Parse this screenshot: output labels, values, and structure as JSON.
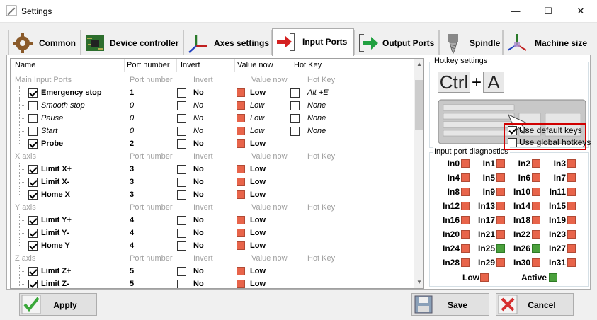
{
  "window": {
    "title": "Settings",
    "min": "—",
    "max": "☐",
    "close": "✕"
  },
  "tabs": [
    {
      "label": "Common"
    },
    {
      "label": "Device controller"
    },
    {
      "label": "Axes settings"
    },
    {
      "label": "Input Ports"
    },
    {
      "label": "Output Ports"
    },
    {
      "label": "Spindle"
    },
    {
      "label": "Machine size"
    }
  ],
  "grid": {
    "headers": {
      "name": "Name",
      "port": "Port number",
      "invert": "Invert",
      "value": "Value now",
      "hotkey": "Hot Key"
    },
    "groups": [
      {
        "label": "Main Input Ports",
        "port": "Port number",
        "invert": "Invert",
        "value": "Value now",
        "hotkey": "Hot Key"
      },
      {
        "label": "X axis",
        "port": "Port number",
        "invert": "Invert",
        "value": "Value now",
        "hotkey": "Hot Key"
      },
      {
        "label": "Y axis",
        "port": "Port number",
        "invert": "Invert",
        "value": "Value now",
        "hotkey": "Hot Key"
      },
      {
        "label": "Z axis",
        "port": "Port number",
        "invert": "Invert",
        "value": "Value now",
        "hotkey": "Hot Key"
      }
    ],
    "rows": [
      {
        "name": "Emergency stop",
        "port": "1",
        "invert": "No",
        "value": "Low",
        "hotkey": "Alt +E"
      },
      {
        "name": "Smooth stop",
        "port": "0",
        "invert": "No",
        "value": "Low",
        "hotkey": "None"
      },
      {
        "name": "Pause",
        "port": "0",
        "invert": "No",
        "value": "Low",
        "hotkey": "None"
      },
      {
        "name": "Start",
        "port": "0",
        "invert": "No",
        "value": "Low",
        "hotkey": "None"
      },
      {
        "name": "Probe",
        "port": "2",
        "invert": "No",
        "value": "Low",
        "hotkey": ""
      },
      {
        "name": "Limit X+",
        "port": "3",
        "invert": "No",
        "value": "Low",
        "hotkey": ""
      },
      {
        "name": "Limit X-",
        "port": "3",
        "invert": "No",
        "value": "Low",
        "hotkey": ""
      },
      {
        "name": "Home X",
        "port": "3",
        "invert": "No",
        "value": "Low",
        "hotkey": ""
      },
      {
        "name": "Limit Y+",
        "port": "4",
        "invert": "No",
        "value": "Low",
        "hotkey": ""
      },
      {
        "name": "Limit Y-",
        "port": "4",
        "invert": "No",
        "value": "Low",
        "hotkey": ""
      },
      {
        "name": "Home Y",
        "port": "4",
        "invert": "No",
        "value": "Low",
        "hotkey": ""
      },
      {
        "name": "Limit Z+",
        "port": "5",
        "invert": "No",
        "value": "Low",
        "hotkey": ""
      },
      {
        "name": "Limit Z-",
        "port": "5",
        "invert": "No",
        "value": "Low",
        "hotkey": ""
      }
    ]
  },
  "hotkey": {
    "title": "Hotkey settings",
    "key1": "Ctrl",
    "plus": "+",
    "key2": "A",
    "use_default": "Use default keys",
    "use_global": "Use global hotkeys"
  },
  "diag": {
    "title": "Input port diagnostics",
    "inputs": [
      "In0",
      "In1",
      "In2",
      "In3",
      "In4",
      "In5",
      "In6",
      "In7",
      "In8",
      "In9",
      "In10",
      "In11",
      "In12",
      "In13",
      "In14",
      "In15",
      "In16",
      "In17",
      "In18",
      "In19",
      "In20",
      "In21",
      "In22",
      "In23",
      "In24",
      "In25",
      "In26",
      "In27",
      "In28",
      "In29",
      "In30",
      "In31"
    ],
    "active_inputs": [
      "In25",
      "In26"
    ],
    "legend_low": "Low",
    "legend_active": "Active"
  },
  "buttons": {
    "apply": "Apply",
    "save": "Save",
    "cancel": "Cancel"
  },
  "colors": {
    "low": "#e8644a",
    "active": "#4aa03c",
    "highlight": "#d00000"
  }
}
